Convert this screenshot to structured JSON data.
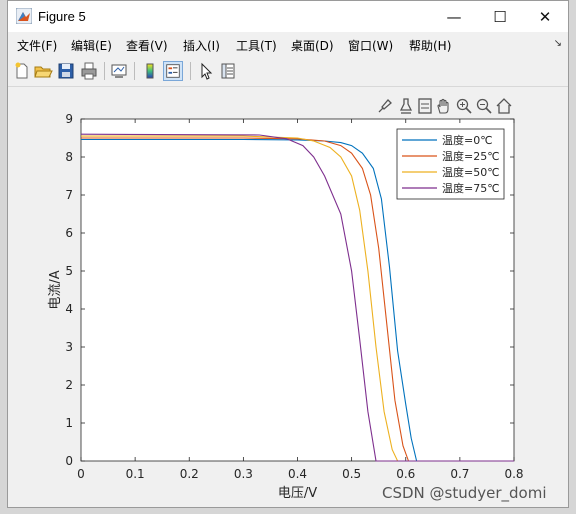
{
  "window": {
    "title": "Figure 5",
    "minimize": "—",
    "maximize": "☐",
    "close": "✕"
  },
  "menu": [
    "文件(F)",
    "编辑(E)",
    "查看(V)",
    "插入(I)",
    "工具(T)",
    "桌面(D)",
    "窗口(W)",
    "帮助(H)"
  ],
  "toolbar_icons": [
    "new-figure-icon",
    "open-file-icon",
    "save-icon",
    "print-icon",
    "link-plot-icon",
    "colorbar-icon",
    "legend-icon",
    "pointer-icon",
    "property-inspector-icon"
  ],
  "axes_toolbar_icons": [
    "brush-icon",
    "data-tips-icon",
    "insert-legend-icon",
    "pan-icon",
    "zoom-in-icon",
    "zoom-out-icon",
    "home-icon"
  ],
  "watermark": "CSDN @studyer_domi",
  "chart_data": {
    "type": "line",
    "title": "",
    "xlabel": "电压/V",
    "ylabel": "电流/A",
    "xlim": [
      0,
      0.8
    ],
    "ylim": [
      0,
      9
    ],
    "xticks": [
      "0",
      "0.1",
      "0.2",
      "0.3",
      "0.4",
      "0.5",
      "0.6",
      "0.7",
      "0.8"
    ],
    "yticks": [
      "0",
      "1",
      "2",
      "3",
      "4",
      "5",
      "6",
      "7",
      "8",
      "9"
    ],
    "grid": false,
    "legend_position": "top-right",
    "series": [
      {
        "name": "温度=0℃",
        "color": "#0072BD",
        "x": [
          0,
          0.3,
          0.4,
          0.45,
          0.48,
          0.5,
          0.52,
          0.54,
          0.555,
          0.57,
          0.585,
          0.6,
          0.61,
          0.62,
          0.8
        ],
        "y": [
          8.46,
          8.46,
          8.45,
          8.42,
          8.38,
          8.3,
          8.1,
          7.7,
          6.9,
          5.1,
          2.9,
          1.5,
          0.6,
          0,
          0
        ]
      },
      {
        "name": "温度=25℃",
        "color": "#D95319",
        "x": [
          0,
          0.3,
          0.4,
          0.45,
          0.48,
          0.5,
          0.52,
          0.535,
          0.55,
          0.565,
          0.58,
          0.595,
          0.605,
          0.8
        ],
        "y": [
          8.5,
          8.5,
          8.48,
          8.42,
          8.3,
          8.1,
          7.7,
          7.0,
          5.6,
          3.6,
          1.6,
          0.4,
          0,
          0
        ]
      },
      {
        "name": "温度=50℃",
        "color": "#EDB120",
        "x": [
          0,
          0.3,
          0.4,
          0.43,
          0.46,
          0.48,
          0.5,
          0.515,
          0.53,
          0.545,
          0.56,
          0.575,
          0.585,
          0.8
        ],
        "y": [
          8.55,
          8.55,
          8.5,
          8.42,
          8.25,
          8.0,
          7.5,
          6.6,
          5.0,
          3.0,
          1.3,
          0.3,
          0,
          0
        ]
      },
      {
        "name": "温度=75℃",
        "color": "#7E2F8E",
        "x": [
          0,
          0.33,
          0.38,
          0.41,
          0.43,
          0.45,
          0.48,
          0.5,
          0.515,
          0.53,
          0.545,
          0.8
        ],
        "y": [
          8.6,
          8.58,
          8.48,
          8.3,
          8.0,
          7.5,
          6.5,
          5.0,
          3.2,
          1.3,
          0,
          0
        ]
      }
    ]
  }
}
